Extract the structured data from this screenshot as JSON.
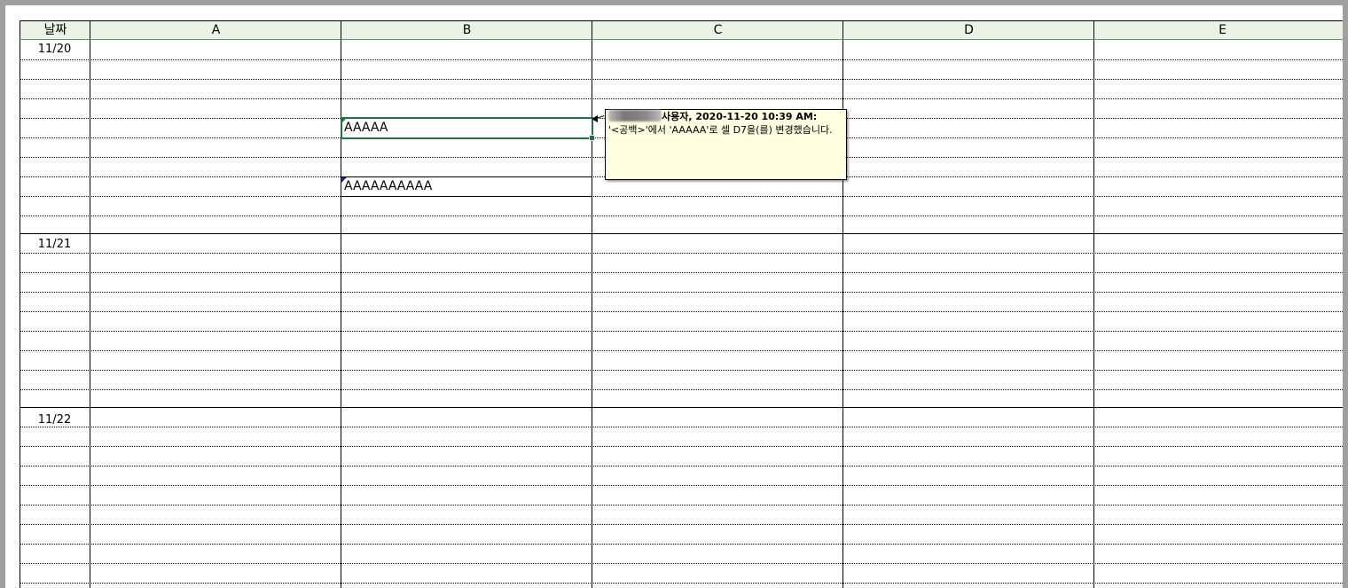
{
  "sheet": {
    "columns": [
      "날짜",
      "A",
      "B",
      "C",
      "D",
      "E"
    ],
    "dates": [
      "11/20",
      "11/21",
      "11/22"
    ],
    "cells": {
      "b_row4": "AAAAA",
      "b_row7": "AAAAAAAAAA"
    }
  },
  "comment": {
    "author": "사용자, 2020-11-20 10:39 AM:",
    "text": "'<공백>'에서 'AAAAA'로 셀 D7을(를) 변경했습니다."
  },
  "colors": {
    "header_bg": "#eaf3e5",
    "selection": "#217346",
    "note_bg": "#ffffe1",
    "change_marker": "#1b2a8c"
  }
}
